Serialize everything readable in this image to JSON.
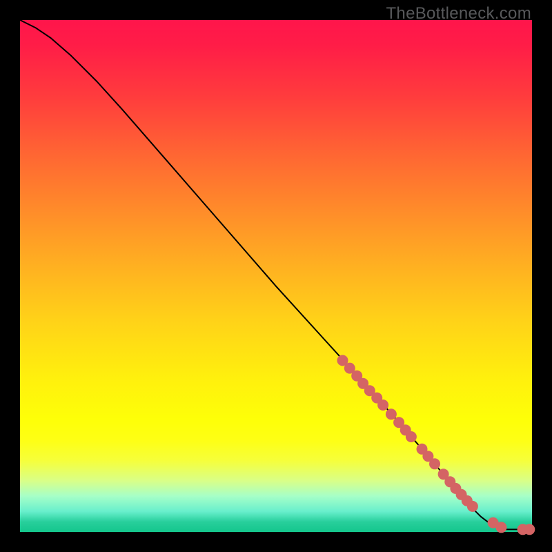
{
  "watermark": "TheBottleneck.com",
  "colors": {
    "background": "#000000",
    "marker": "#d46464",
    "line": "#000000"
  },
  "chart_data": {
    "type": "line",
    "title": "",
    "xlabel": "",
    "ylabel": "",
    "xlim": [
      0,
      100
    ],
    "ylim": [
      0,
      100
    ],
    "grid": false,
    "legend": false,
    "series": [
      {
        "name": "curve",
        "x": [
          0,
          3,
          6,
          10,
          15,
          20,
          30,
          40,
          50,
          60,
          70,
          80,
          85,
          88,
          90,
          92,
          95,
          99,
          100
        ],
        "y": [
          100,
          98.5,
          96.5,
          93,
          88,
          82.5,
          71,
          59.5,
          48,
          37,
          26,
          14.5,
          8.5,
          5,
          3,
          1.5,
          0.5,
          0.5,
          0.5
        ]
      }
    ],
    "markers": {
      "name": "highlighted-points",
      "x": [
        63,
        64.4,
        65.8,
        67.0,
        68.3,
        69.7,
        70.9,
        72.5,
        74.0,
        75.3,
        76.4,
        78.5,
        79.7,
        81.0,
        82.7,
        84,
        85.1,
        86.2,
        87.3,
        88.4,
        92.4,
        94.0,
        98.2,
        99.5
      ],
      "y": [
        33.5,
        32.0,
        30.5,
        29.0,
        27.6,
        26.2,
        24.8,
        23.0,
        21.4,
        19.9,
        18.6,
        16.2,
        14.8,
        13.3,
        11.3,
        9.8,
        8.5,
        7.3,
        6.1,
        5.0,
        1.8,
        0.9,
        0.5,
        0.5
      ]
    }
  }
}
